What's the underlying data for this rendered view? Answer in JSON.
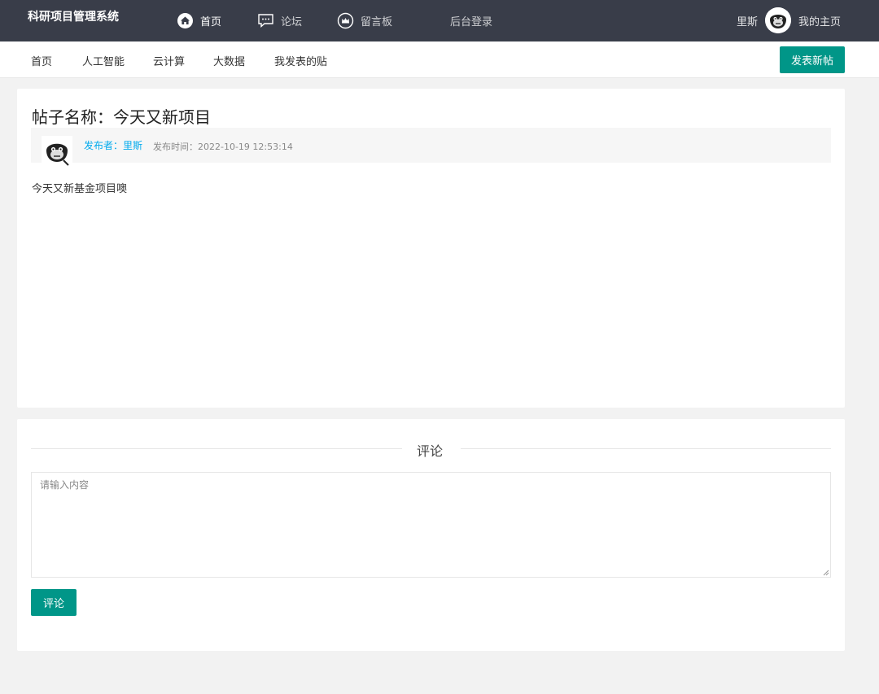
{
  "header": {
    "brand": "科研项目管理系统",
    "nav": [
      {
        "label": "首页",
        "icon": "home-icon"
      },
      {
        "label": "论坛",
        "icon": "chat-icon"
      },
      {
        "label": "留言板",
        "icon": "crown-icon"
      },
      {
        "label": "后台登录",
        "icon": ""
      }
    ],
    "user_name": "里斯",
    "my_home": "我的主页"
  },
  "subnav": {
    "items": [
      "首页",
      "人工智能",
      "云计算",
      "大数据",
      "我发表的贴"
    ],
    "post_button": "发表新帖"
  },
  "post": {
    "title": "帖子名称：今天又新项目",
    "author": "发布者：里斯",
    "time": "发布时间：2022-10-19 12:53:14",
    "body": "今天又新基金项目噢"
  },
  "comment": {
    "heading": "评论",
    "placeholder": "请输入内容",
    "value": "",
    "submit_label": "评论"
  },
  "colors": {
    "topbar": "#393d49",
    "accent": "#009688",
    "link": "#01aaed",
    "background": "#f2f2f2"
  }
}
